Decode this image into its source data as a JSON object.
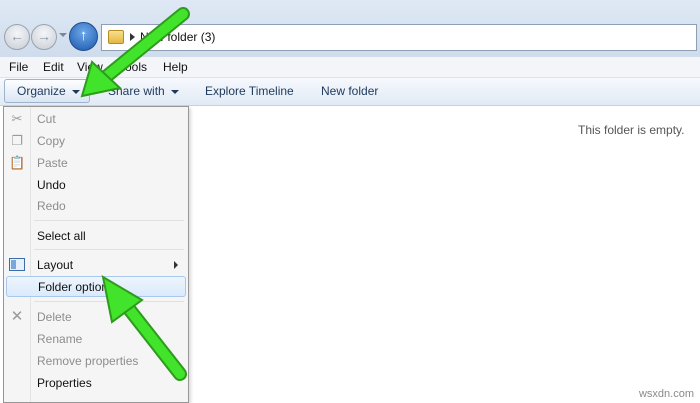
{
  "address": {
    "path": "New folder (3)"
  },
  "menubar": [
    "File",
    "Edit",
    "View",
    "Tools",
    "Help"
  ],
  "toolbar": {
    "organize": "Organize",
    "share": "Share with",
    "timeline": "Explore Timeline",
    "newfolder": "New folder"
  },
  "content": {
    "empty_message": "This folder is empty."
  },
  "organize_menu": {
    "cut": "Cut",
    "copy": "Copy",
    "paste": "Paste",
    "undo": "Undo",
    "redo": "Redo",
    "select_all": "Select all",
    "layout": "Layout",
    "folder_options": "Folder options",
    "delete": "Delete",
    "rename": "Rename",
    "remove_properties": "Remove properties",
    "properties": "Properties"
  },
  "watermark": "wsxdn.com",
  "colors": {
    "annotation_arrow": "#3fe02a",
    "highlight": "#dbeafb"
  }
}
